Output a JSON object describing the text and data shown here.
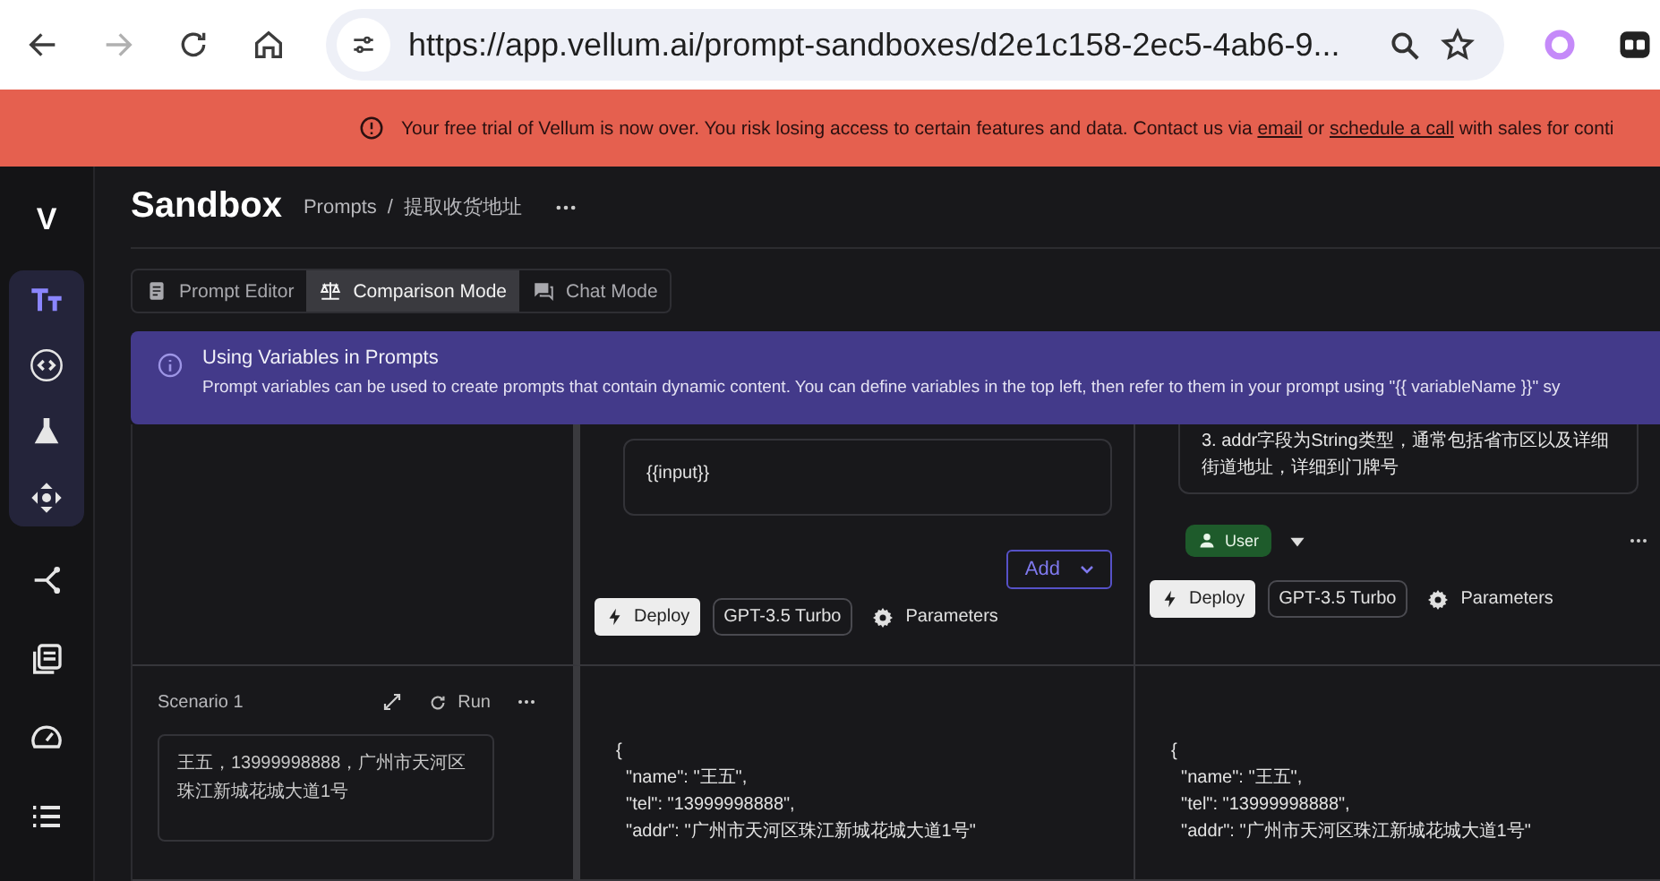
{
  "browser": {
    "url": "https://app.vellum.ai/prompt-sandboxes/d2e1c158-2ec5-4ab6-9...",
    "forward_disabled": true
  },
  "banner": {
    "segments": [
      {
        "kind": "text",
        "text": "Your free trial of Vellum is now over. You risk losing access to certain features and data. Contact us via "
      },
      {
        "kind": "link",
        "text": "email"
      },
      {
        "kind": "text",
        "text": " or "
      },
      {
        "kind": "link",
        "text": "schedule a call"
      },
      {
        "kind": "text",
        "text": " with sales for conti"
      }
    ]
  },
  "sidebar": {
    "logo": "V",
    "items": [
      {
        "selected": true
      },
      {
        "selected": false
      },
      {
        "selected": false
      },
      {
        "selected": false
      },
      {
        "selected": false
      },
      {
        "selected": false
      },
      {
        "selected": false
      },
      {
        "selected": false
      }
    ]
  },
  "header": {
    "title": "Sandbox",
    "breadcrumbs": [
      "Prompts",
      "提取收货地址"
    ],
    "separator": "/"
  },
  "tabs": [
    {
      "label": "Prompt Editor",
      "selected": false
    },
    {
      "label": "Comparison Mode",
      "selected": true
    },
    {
      "label": "Chat Mode",
      "selected": false
    }
  ],
  "info": {
    "title": "Using Variables in Prompts",
    "text": "Prompt variables can be used to create prompts that contain dynamic content. You can define variables in the top left, then refer to them in your prompt using \"{{ variableName }}\" sy"
  },
  "prompts": [
    {
      "kind": "input",
      "content": "{{input}}",
      "add": "Add",
      "deploy": "Deploy",
      "model": "GPT-3.5 Turbo",
      "parameters": "Parameters"
    },
    {
      "kind": "message",
      "content": "3. addr字段为String类型，通常包括省市区以及详细街道地址，详细到门牌号",
      "role": "User",
      "deploy": "Deploy",
      "model": "GPT-3.5 Turbo",
      "parameters": "Parameters"
    }
  ],
  "scenario": {
    "name": "Scenario 1",
    "run": "Run",
    "input": "王五，13999998888，广州市天河区珠江新城花城大道1号"
  },
  "outputs": [
    {
      "lines": [
        "{",
        "  \"name\": \"王五\",",
        "  \"tel\": \"13999998888\",",
        "  \"addr\": \"广州市天河区珠江新城花城大道1号\""
      ]
    },
    {
      "lines": [
        "{",
        "  \"name\": \"王五\",",
        "  \"tel\": \"13999998888\",",
        "  \"addr\": \"广州市天河区珠江新城花城大道1号\""
      ]
    }
  ]
}
